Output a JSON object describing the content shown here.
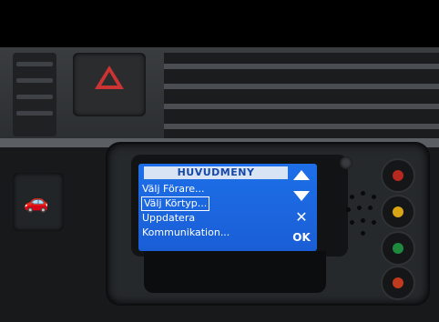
{
  "device_screen": {
    "menu_title": "HUVUDMENY",
    "items": [
      {
        "label": "Välj Förare..."
      },
      {
        "label": "Välj Körtyp..."
      },
      {
        "label": "Uppdatera"
      },
      {
        "label": "Kommunikation..."
      }
    ],
    "selected_index": 1,
    "controls": {
      "up_icon": "triangle-up-icon",
      "down_icon": "triangle-down-icon",
      "close_label": "✕",
      "ok_label": "OK"
    }
  },
  "colors": {
    "screen_bg": "#1d6fe8",
    "header_bg": "#d8e4f4",
    "header_text": "#1648a8",
    "hazard": "#cc3333",
    "led_red": "#b8281e",
    "led_yellow": "#d9a514",
    "led_green": "#1e8a3e",
    "led_orange": "#c23a1e"
  }
}
